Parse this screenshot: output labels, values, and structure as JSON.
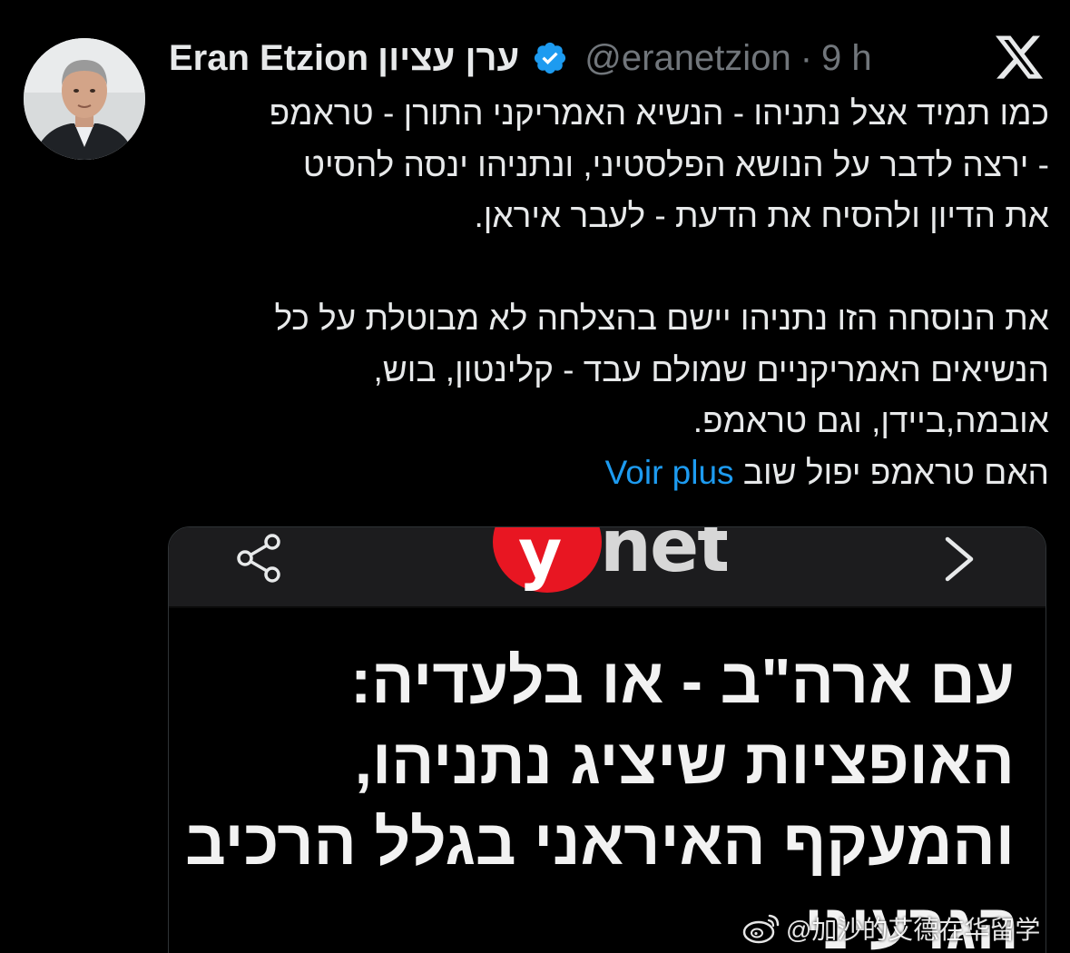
{
  "author": {
    "display_name": "Eran Etzion",
    "display_name_he": "ערן עציון",
    "handle": "@eranetzion",
    "separator": "·",
    "time": "9 h",
    "verified": true,
    "avatar_icon": "profile-photo"
  },
  "tweet": {
    "paragraph1": [
      "כמו תמיד אצל נתניהו - הנשיא האמריקני התורן - טראמפ",
      "- ירצה לדבר על הנושא הפלסטיני, ונתניהו ינסה להסיט",
      "את הדיון ולהסיח את הדעת - לעבר איראן."
    ],
    "paragraph2": [
      "את הנוסחה הזו נתניהו יישם בהצלחה לא מבוטלת על כל",
      "הנשיאים האמריקניים שמולם עבד - קלינטון, בוש,",
      "אובמה,ביידן, וגם טראמפ."
    ],
    "last_line": "האם טראמפ יפול שוב",
    "see_more": "Voir plus"
  },
  "card": {
    "logo_letter": "y",
    "logo_rest": "net",
    "headline_lines": [
      "עם ארה\"ב - או בלעדיה:",
      "האופציות שיציג נתניהו,",
      "והמעקף האיראני בגלל הרכיב"
    ],
    "headline_cut": "הגרעיני",
    "share_icon": "share-icon",
    "next_icon": "chevron-right-icon"
  },
  "watermark": {
    "text": "@加沙的艾德在华留学"
  },
  "colors": {
    "background": "#000000",
    "text": "#e7e9ea",
    "secondary": "#71767b",
    "link": "#1d9bf0",
    "verified": "#1d9bf0",
    "ynet_red": "#e81622"
  }
}
